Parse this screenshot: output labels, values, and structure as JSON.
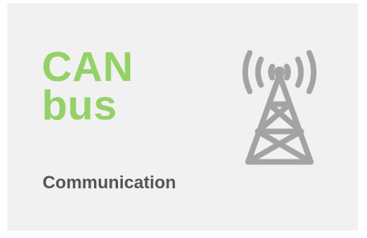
{
  "card": {
    "title_line1": "CAN",
    "title_line2": "bus",
    "subtitle": "Communication",
    "icon": "radio-tower-icon"
  },
  "colors": {
    "title": "#94d168",
    "subtitle": "#555555",
    "icon": "#a3a3a3",
    "card_background": "#f1f1f1"
  }
}
